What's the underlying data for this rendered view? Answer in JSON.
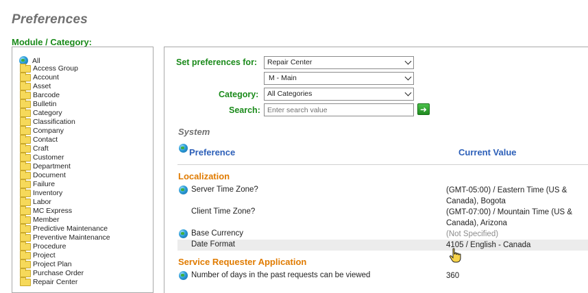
{
  "page": {
    "title": "Preferences",
    "module_label": "Module / Category:"
  },
  "tree": {
    "root_label": "All",
    "items": [
      "Access Group",
      "Account",
      "Asset",
      "Barcode",
      "Bulletin",
      "Category",
      "Classification",
      "Company",
      "Contact",
      "Craft",
      "Customer",
      "Department",
      "Document",
      "Failure",
      "Inventory",
      "Labor",
      "MC Express",
      "Member",
      "Predictive Maintenance",
      "Preventive Maintenance",
      "Procedure",
      "Project",
      "Project Plan",
      "Purchase Order",
      "Repair Center"
    ]
  },
  "filters": {
    "set_prefs_label": "Set preferences for:",
    "set_prefs_value": "Repair Center",
    "repair_center_value": "M - Main",
    "category_label": "Category:",
    "category_value": "All Categories",
    "search_label": "Search:",
    "search_placeholder": "Enter search value",
    "search_value": ""
  },
  "table": {
    "section_title": "System",
    "col_preference": "Preference",
    "col_current_value": "Current Value",
    "groups": [
      {
        "title": "Localization",
        "rows": [
          {
            "name": "Server Time Zone?",
            "value_line1": "(GMT-05:00) / Eastern Time (US &",
            "value_line2": "Canada), Bogota"
          },
          {
            "name": "Client Time Zone?",
            "value_line1": "(GMT-07:00) / Mountain Time (US &",
            "value_line2": "Canada), Arizona"
          },
          {
            "name": "Base Currency",
            "value_line1": "(Not Specified)"
          },
          {
            "name": "Date Format",
            "value_line1": "4105 / English - Canada"
          }
        ]
      },
      {
        "title": "Service Requester Application",
        "rows": [
          {
            "name": "Number of days in the past requests can be viewed",
            "value_line1": "360"
          }
        ]
      }
    ]
  },
  "colors": {
    "label_green": "#1a8a1a",
    "header_blue": "#2c5fb8",
    "group_orange": "#e07b00",
    "muted_gray": "#8c8c8c"
  },
  "icons": [
    "globe-icon",
    "folder-icon",
    "chevron-down-icon",
    "arrow-right-icon",
    "hand-cursor-icon"
  ]
}
